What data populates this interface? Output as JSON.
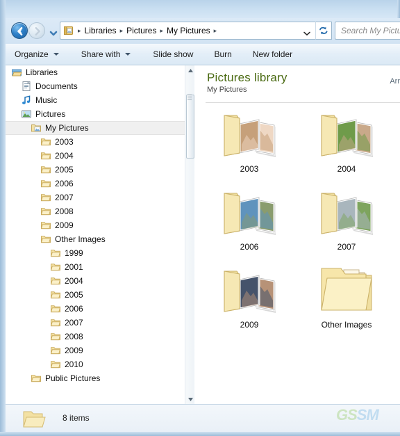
{
  "window": {
    "title": "My Pictures"
  },
  "address": {
    "back_tooltip": "Back",
    "forward_tooltip": "Forward",
    "recent_tooltip": "Recent pages",
    "crumb_icon": "library-folder-icon",
    "breadcrumbs": [
      "Libraries",
      "Pictures",
      "My Pictures"
    ],
    "dropdown_tooltip": "Previous locations",
    "refresh_tooltip": "Refresh"
  },
  "search": {
    "placeholder": "Search My Pictur",
    "value": ""
  },
  "toolbar": {
    "items": [
      {
        "label": "Organize",
        "has_menu": true
      },
      {
        "label": "Share with",
        "has_menu": true
      },
      {
        "label": "Slide show",
        "has_menu": false
      },
      {
        "label": "Burn",
        "has_menu": false
      },
      {
        "label": "New folder",
        "has_menu": false
      }
    ]
  },
  "tree": {
    "nodes": [
      {
        "label": "Libraries",
        "indent": 0,
        "icon": "libraries-icon",
        "selected": false
      },
      {
        "label": "Documents",
        "indent": 1,
        "icon": "documents-icon",
        "selected": false
      },
      {
        "label": "Music",
        "indent": 1,
        "icon": "music-icon",
        "selected": false
      },
      {
        "label": "Pictures",
        "indent": 1,
        "icon": "pictures-icon",
        "selected": false
      },
      {
        "label": "My Pictures",
        "indent": 2,
        "icon": "my-pictures-icon",
        "selected": true
      },
      {
        "label": "2003",
        "indent": 3,
        "icon": "folder-icon",
        "selected": false
      },
      {
        "label": "2004",
        "indent": 3,
        "icon": "folder-icon",
        "selected": false
      },
      {
        "label": "2005",
        "indent": 3,
        "icon": "folder-icon",
        "selected": false
      },
      {
        "label": "2006",
        "indent": 3,
        "icon": "folder-icon",
        "selected": false
      },
      {
        "label": "2007",
        "indent": 3,
        "icon": "folder-icon",
        "selected": false
      },
      {
        "label": "2008",
        "indent": 3,
        "icon": "folder-icon",
        "selected": false
      },
      {
        "label": "2009",
        "indent": 3,
        "icon": "folder-icon",
        "selected": false
      },
      {
        "label": "Other Images",
        "indent": 3,
        "icon": "folder-icon",
        "selected": false
      },
      {
        "label": "1999",
        "indent": 4,
        "icon": "folder-icon",
        "selected": false
      },
      {
        "label": "2001",
        "indent": 4,
        "icon": "folder-icon",
        "selected": false
      },
      {
        "label": "2004",
        "indent": 4,
        "icon": "folder-icon",
        "selected": false
      },
      {
        "label": "2005",
        "indent": 4,
        "icon": "folder-icon",
        "selected": false
      },
      {
        "label": "2006",
        "indent": 4,
        "icon": "folder-icon",
        "selected": false
      },
      {
        "label": "2007",
        "indent": 4,
        "icon": "folder-icon",
        "selected": false
      },
      {
        "label": "2008",
        "indent": 4,
        "icon": "folder-icon",
        "selected": false
      },
      {
        "label": "2009",
        "indent": 4,
        "icon": "folder-icon",
        "selected": false
      },
      {
        "label": "2010",
        "indent": 4,
        "icon": "folder-icon",
        "selected": false
      },
      {
        "label": "Public Pictures",
        "indent": 2,
        "icon": "folder-icon",
        "selected": false
      }
    ]
  },
  "library": {
    "title": "Pictures library",
    "subtitle": "My Pictures",
    "arrange_label": "Arr"
  },
  "items": [
    {
      "name": "2003",
      "type": "photo-folder",
      "photos": [
        "#c6a07a",
        "#efd8c4"
      ]
    },
    {
      "name": "2004",
      "type": "photo-folder",
      "photos": [
        "#6f9b4a",
        "#c9a98a"
      ]
    },
    {
      "name": "2006",
      "type": "photo-folder",
      "photos": [
        "#5f93bd",
        "#8a9c6e"
      ]
    },
    {
      "name": "2007",
      "type": "photo-folder",
      "photos": [
        "#a9b6bd",
        "#7ea45e"
      ]
    },
    {
      "name": "2009",
      "type": "photo-folder",
      "photos": [
        "#45536b",
        "#b79277"
      ]
    },
    {
      "name": "Other Images",
      "type": "stacked-folder",
      "photos": []
    }
  ],
  "status": {
    "count_text": "8 items",
    "icon": "folder-picture-icon"
  },
  "watermark": {
    "text_a": "GS",
    "text_b": "SM"
  },
  "colors": {
    "library_title": "#4a6a12",
    "folder_body": "#f5e3a8",
    "folder_edge": "#e3ca79",
    "selection": "#f0f0f0",
    "frame": "#cfe1f1"
  }
}
